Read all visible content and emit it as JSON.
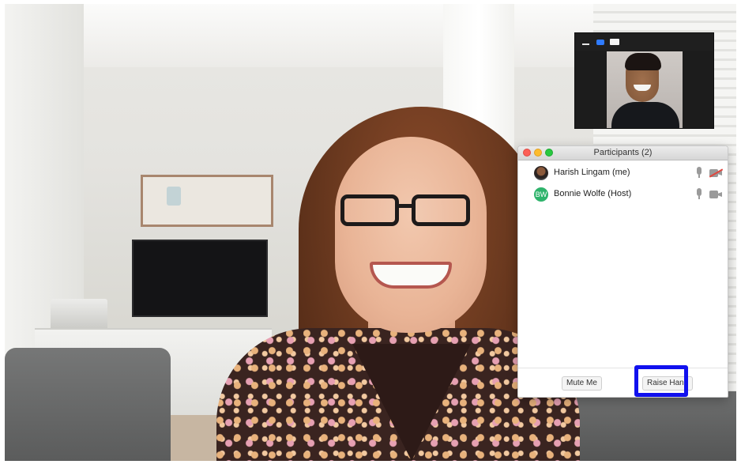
{
  "window": {
    "type": "video-call"
  },
  "self_view": {
    "controls": [
      "minimize-icon",
      "active-view-icon",
      "window-view-icon"
    ]
  },
  "participants_panel": {
    "title": "Participants (2)",
    "participants": [
      {
        "name": "Harish Lingam (me)",
        "avatar": "photo",
        "mic": "microphone-icon",
        "video": "video-off-icon"
      },
      {
        "name": "Bonnie Wolfe (Host)",
        "avatar_initials": "BW",
        "avatar_color": "#2eb36b",
        "mic": "microphone-icon",
        "video": "video-camera-icon"
      }
    ],
    "buttons": {
      "mute": "Mute Me",
      "raise_hand": "Raise Hand"
    }
  },
  "colors": {
    "highlight": "#1111ee",
    "traffic_close": "#fc5f57",
    "traffic_min": "#fdbc2e",
    "traffic_max": "#28c840",
    "video_off_slash": "#e0473f"
  }
}
